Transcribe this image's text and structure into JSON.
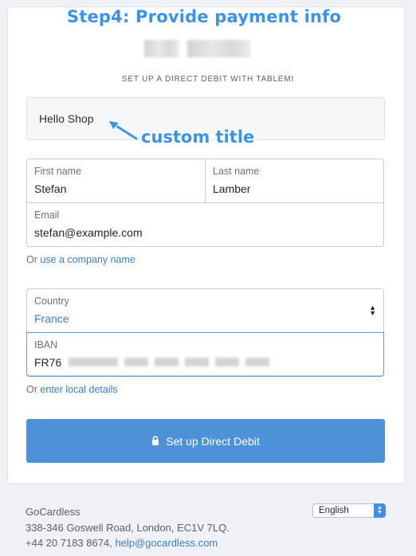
{
  "annotations": {
    "step": "Step4: Provide payment info",
    "custom_title": "custom title"
  },
  "header": {
    "subtitle": "SET UP A DIRECT DEBIT WITH TABLEMI",
    "title_box": "Hello Shop"
  },
  "form": {
    "first_name": {
      "label": "First name",
      "value": "Stefan"
    },
    "last_name": {
      "label": "Last name",
      "value": "Lamber"
    },
    "email": {
      "label": "Email",
      "value": "stefan@example.com"
    },
    "company_prefix": "Or",
    "company_link": "use a company name",
    "country": {
      "label": "Country",
      "value": "France"
    },
    "iban": {
      "label": "IBAN",
      "value": "FR76"
    },
    "local_prefix": "Or",
    "local_link": "enter local details",
    "submit_label": "Set up Direct Debit"
  },
  "footer": {
    "company": "GoCardless",
    "address": "338-346 Goswell Road, London, EC1V 7LQ.",
    "phone": "+44 20 7183 8674,",
    "email": "help@gocardless.com",
    "language": "English"
  },
  "colors": {
    "accent": "#3b93e8",
    "button": "#4d91d8",
    "link": "#3b7fc4"
  }
}
